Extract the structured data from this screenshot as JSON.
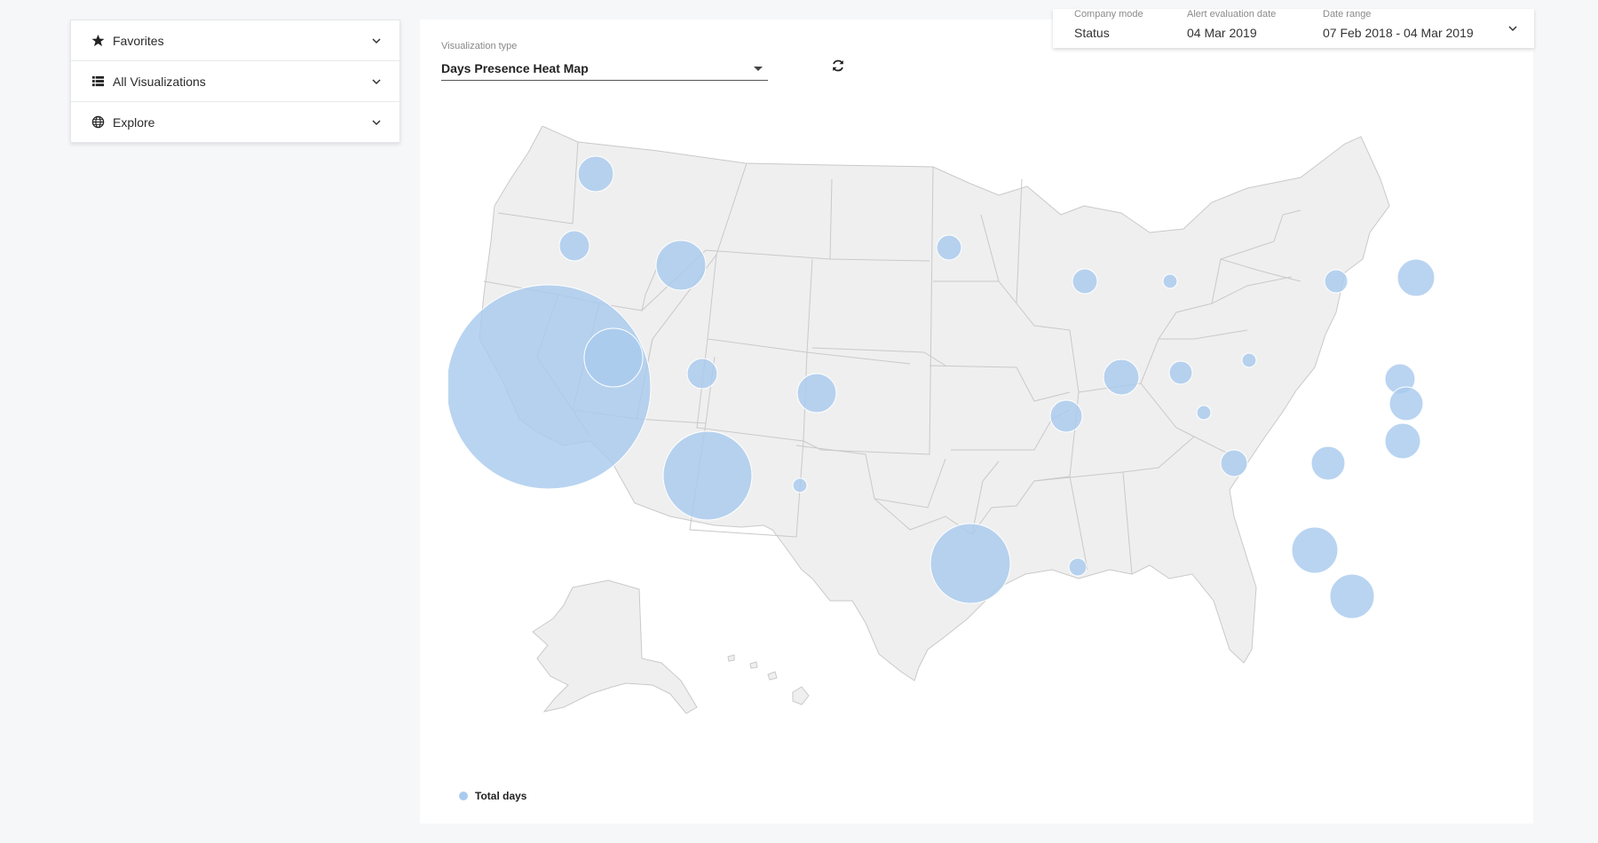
{
  "sidebar": {
    "items": [
      {
        "label": "Favorites",
        "icon": "star-icon"
      },
      {
        "label": "All Visualizations",
        "icon": "list-icon"
      },
      {
        "label": "Explore",
        "icon": "globe-icon"
      }
    ]
  },
  "visualization": {
    "type_label": "Visualization type",
    "type_value": "Days Presence Heat Map"
  },
  "filters": {
    "company_mode_label": "Company mode",
    "company_mode_value": "Status",
    "alert_date_label": "Alert evaluation date",
    "alert_date_value": "04 Mar 2019",
    "date_range_label": "Date range",
    "date_range_value": "07 Feb 2018 - 04 Mar 2019"
  },
  "legend": {
    "label": "Total days"
  },
  "colors": {
    "bubble": "#a9cbee",
    "land": "#efefef",
    "border": "#c9c9c9"
  }
}
